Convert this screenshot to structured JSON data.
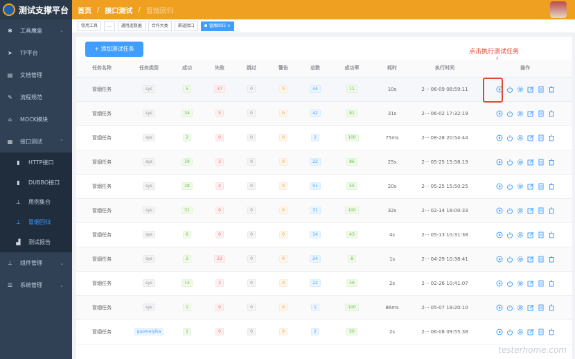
{
  "header": {
    "app_title": "测试支撑平台",
    "breadcrumbs": [
      "首页",
      "接口测试",
      "冒烟回归"
    ]
  },
  "sidebar": {
    "items": [
      {
        "label": "工具魔盒",
        "icon": "cog-icon",
        "chevron": true
      },
      {
        "label": "TP平台",
        "icon": "send-icon",
        "chevron": false
      },
      {
        "label": "文档管理",
        "icon": "doc-icon",
        "chevron": false
      },
      {
        "label": "流程规范",
        "icon": "edit-icon",
        "chevron": false
      },
      {
        "label": "MOCK模块",
        "icon": "home-icon",
        "chevron": false
      },
      {
        "label": "接口测试",
        "icon": "grid-icon",
        "chevron": true,
        "expanded": true
      }
    ],
    "sub_items": [
      {
        "label": "HTTP接口",
        "icon": "bar-icon"
      },
      {
        "label": "DUBBO接口",
        "icon": "bar-icon"
      },
      {
        "label": "用例集合",
        "icon": "tree-icon"
      },
      {
        "label": "冒烟回归",
        "icon": "tree-icon",
        "active": true
      },
      {
        "label": "测试报告",
        "icon": "chart-icon"
      }
    ],
    "bottom_items": [
      {
        "label": "组件管理",
        "icon": "tree-icon"
      },
      {
        "label": "系统管理",
        "icon": "list-icon"
      }
    ]
  },
  "tabs": [
    "常用工具",
    "...",
    "通用造数据",
    "合作大类",
    "渠道接口",
    "冒烟回归"
  ],
  "active_tab": "冒烟回归",
  "toolbar": {
    "add_label": "+ 添加测试任务"
  },
  "annotation": {
    "text": "点击执行测试任务"
  },
  "table": {
    "columns": [
      "任务名称",
      "任务类型",
      "成功",
      "失败",
      "跳过",
      "警告",
      "总数",
      "成功率",
      "耗时",
      "执行时间",
      "操作"
    ],
    "rows": [
      {
        "name": "冒烟任务",
        "type": "sys",
        "success": "5",
        "fail": "37",
        "skip": "0",
        "warn": "0",
        "total": "44",
        "rate": "11",
        "duration": "10s",
        "time": "2··· 06-09 08:59:11"
      },
      {
        "name": "冒烟任务",
        "type": "sys",
        "success": "34",
        "fail": "5",
        "skip": "0",
        "warn": "0",
        "total": "42",
        "rate": "81",
        "duration": "31s",
        "time": "2··· 06-02 17:32:19"
      },
      {
        "name": "冒烟任务",
        "type": "sys",
        "success": "2",
        "fail": "0",
        "skip": "0",
        "warn": "0",
        "total": "2",
        "rate": "100",
        "duration": "75ms",
        "time": "2··· 08-28 20:54:44"
      },
      {
        "name": "冒烟任务",
        "type": "sys",
        "success": "19",
        "fail": "3",
        "skip": "0",
        "warn": "0",
        "total": "22",
        "rate": "86",
        "duration": "25s",
        "time": "2··· 05-25 15:58:19"
      },
      {
        "name": "冒烟任务",
        "type": "sys",
        "success": "28",
        "fail": "4",
        "skip": "0",
        "warn": "0",
        "total": "51",
        "rate": "55",
        "duration": "20s",
        "time": "2··· 05-25 15:50:25"
      },
      {
        "name": "冒烟任务",
        "type": "sys",
        "success": "31",
        "fail": "0",
        "skip": "0",
        "warn": "0",
        "total": "31",
        "rate": "100",
        "duration": "32s",
        "time": "2··· 02-14 18:00:33"
      },
      {
        "name": "冒烟任务",
        "type": "sys",
        "success": "6",
        "fail": "0",
        "skip": "0",
        "warn": "0",
        "total": "14",
        "rate": "43",
        "duration": "4s",
        "time": "2··· 05-13 10:31:38"
      },
      {
        "name": "冒烟任务",
        "type": "sys",
        "success": "2",
        "fail": "22",
        "skip": "0",
        "warn": "0",
        "total": "24",
        "rate": "8",
        "duration": "1s",
        "time": "2··· 04-29 10:38:41"
      },
      {
        "name": "冒烟任务",
        "type": "sys",
        "success": "13",
        "fail": "3",
        "skip": "0",
        "warn": "0",
        "total": "22",
        "rate": "59",
        "duration": "2s",
        "time": "2··· 02-26 10:41:07"
      },
      {
        "name": "冒烟任务",
        "type": "sys",
        "success": "1",
        "fail": "0",
        "skip": "0",
        "warn": "0",
        "total": "1",
        "rate": "100",
        "duration": "86ms",
        "time": "2··· 05-07 19:20:10"
      },
      {
        "name": "冒烟任务",
        "type": "guomeiyika",
        "success": "1",
        "fail": "0",
        "skip": "0",
        "warn": "0",
        "total": "2",
        "rate": "50",
        "duration": "2s",
        "time": "2··· 06-08 09:55:38"
      }
    ]
  },
  "watermark": "testerhome.com",
  "colors": {
    "accent": "#409eff",
    "header": "#f0a020",
    "sidebar": "#304156",
    "annotation": "#e2412b"
  }
}
